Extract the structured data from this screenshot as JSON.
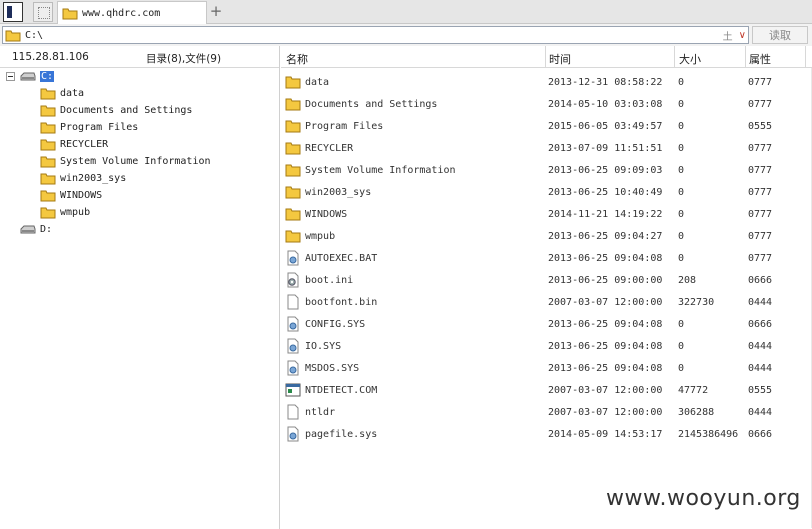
{
  "tab": {
    "label": "www.qhdrc.com",
    "add_label": "+"
  },
  "address": {
    "path": "C:\\",
    "up_glyph": "土",
    "dropdown_glyph": "∨",
    "read_label": "读取"
  },
  "left": {
    "ip": "115.28.81.106",
    "counts": "目录(8),文件(9)",
    "drive_c": "C:",
    "drive_d": "D:",
    "folders": [
      "data",
      "Documents and Settings",
      "Program Files",
      "RECYCLER",
      "System Volume Information",
      "win2003_sys",
      "WINDOWS",
      "wmpub"
    ]
  },
  "columns": {
    "name": "名称",
    "time": "时间",
    "size": "大小",
    "attr": "属性"
  },
  "files": [
    {
      "name": "data",
      "time": "2013-12-31 08:58:22",
      "size": "0",
      "attr": "0777",
      "icon": "folder-icon"
    },
    {
      "name": "Documents and Settings",
      "time": "2014-05-10 03:03:08",
      "size": "0",
      "attr": "0777",
      "icon": "folder-icon"
    },
    {
      "name": "Program Files",
      "time": "2015-06-05 03:49:57",
      "size": "0",
      "attr": "0555",
      "icon": "folder-icon"
    },
    {
      "name": "RECYCLER",
      "time": "2013-07-09 11:51:51",
      "size": "0",
      "attr": "0777",
      "icon": "folder-icon"
    },
    {
      "name": "System Volume Information",
      "time": "2013-06-25 09:09:03",
      "size": "0",
      "attr": "0777",
      "icon": "folder-icon"
    },
    {
      "name": "win2003_sys",
      "time": "2013-06-25 10:40:49",
      "size": "0",
      "attr": "0777",
      "icon": "folder-icon"
    },
    {
      "name": "WINDOWS",
      "time": "2014-11-21 14:19:22",
      "size": "0",
      "attr": "0777",
      "icon": "folder-icon"
    },
    {
      "name": "wmpub",
      "time": "2013-06-25 09:04:27",
      "size": "0",
      "attr": "0777",
      "icon": "folder-icon"
    },
    {
      "name": "AUTOEXEC.BAT",
      "time": "2013-06-25 09:04:08",
      "size": "0",
      "attr": "0777",
      "icon": "system-file-icon"
    },
    {
      "name": "boot.ini",
      "time": "2013-06-25 09:00:00",
      "size": "208",
      "attr": "0666",
      "icon": "settings-file-icon"
    },
    {
      "name": "bootfont.bin",
      "time": "2007-03-07 12:00:00",
      "size": "322730",
      "attr": "0444",
      "icon": "file-icon"
    },
    {
      "name": "CONFIG.SYS",
      "time": "2013-06-25 09:04:08",
      "size": "0",
      "attr": "0666",
      "icon": "system-file-icon"
    },
    {
      "name": "IO.SYS",
      "time": "2013-06-25 09:04:08",
      "size": "0",
      "attr": "0444",
      "icon": "system-file-icon"
    },
    {
      "name": "MSDOS.SYS",
      "time": "2013-06-25 09:04:08",
      "size": "0",
      "attr": "0444",
      "icon": "system-file-icon"
    },
    {
      "name": "NTDETECT.COM",
      "time": "2007-03-07 12:00:00",
      "size": "47772",
      "attr": "0555",
      "icon": "executable-icon"
    },
    {
      "name": "ntldr",
      "time": "2007-03-07 12:00:00",
      "size": "306288",
      "attr": "0444",
      "icon": "file-icon"
    },
    {
      "name": "pagefile.sys",
      "time": "2014-05-09 14:53:17",
      "size": "2145386496",
      "attr": "0666",
      "icon": "system-file-icon"
    }
  ],
  "watermark": "www.wooyun.org"
}
